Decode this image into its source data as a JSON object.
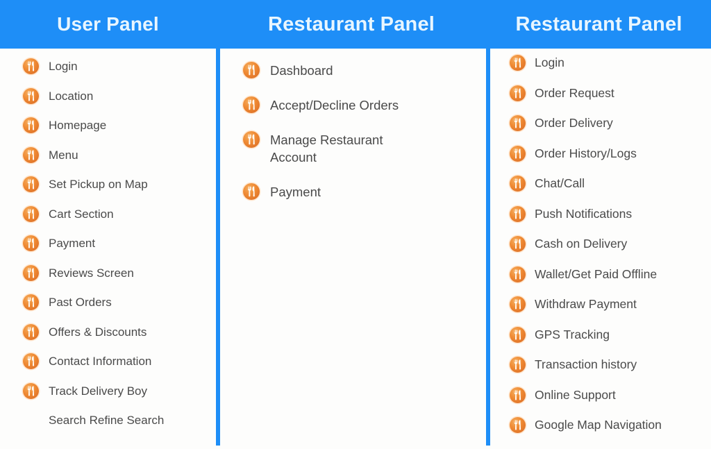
{
  "colors": {
    "header_blue": "#1e8ef7",
    "header_text": "#e8f6ff",
    "divider_blue": "#1e8ef7",
    "icon_orange": "#ef8a33",
    "label_text": "#4a4a4a",
    "background": "#fdfdfc"
  },
  "headers": {
    "col1": "User Panel",
    "col2": "Restaurant Panel",
    "col3": "Restaurant Panel"
  },
  "icon_name": "fork-and-spoon-icon",
  "columns": [
    {
      "key": "user_panel",
      "title": "User Panel",
      "items": [
        {
          "label": "Login",
          "has_icon": true
        },
        {
          "label": "Location",
          "has_icon": true
        },
        {
          "label": "Homepage",
          "has_icon": true
        },
        {
          "label": "Menu",
          "has_icon": true
        },
        {
          "label": "Set Pickup on Map",
          "has_icon": true
        },
        {
          "label": "Cart Section",
          "has_icon": true
        },
        {
          "label": "Payment",
          "has_icon": true
        },
        {
          "label": "Reviews Screen",
          "has_icon": true
        },
        {
          "label": "Past Orders",
          "has_icon": true
        },
        {
          "label": "Offers & Discounts",
          "has_icon": true
        },
        {
          "label": "Contact Information",
          "has_icon": true
        },
        {
          "label": "Track Delivery Boy",
          "has_icon": true
        },
        {
          "label": "Search Refine Search",
          "has_icon": false
        }
      ]
    },
    {
      "key": "restaurant_panel_1",
      "title": "Restaurant Panel",
      "items": [
        {
          "label": "Dashboard",
          "has_icon": true
        },
        {
          "label": "Accept/Decline Orders",
          "has_icon": true
        },
        {
          "label": "Manage Restaurant\nAccount",
          "has_icon": true
        },
        {
          "label": "Payment",
          "has_icon": true
        }
      ]
    },
    {
      "key": "restaurant_panel_2",
      "title": "Restaurant Panel",
      "items": [
        {
          "label": "Login",
          "has_icon": true
        },
        {
          "label": "Order Request",
          "has_icon": true
        },
        {
          "label": "Order Delivery",
          "has_icon": true
        },
        {
          "label": "Order History/Logs",
          "has_icon": true
        },
        {
          "label": "Chat/Call",
          "has_icon": true
        },
        {
          "label": "Push Notifications",
          "has_icon": true
        },
        {
          "label": "Cash on Delivery",
          "has_icon": true
        },
        {
          "label": "Wallet/Get Paid Offline",
          "has_icon": true
        },
        {
          "label": "Withdraw Payment",
          "has_icon": true
        },
        {
          "label": "GPS Tracking",
          "has_icon": true
        },
        {
          "label": "Transaction history",
          "has_icon": true
        },
        {
          "label": "Online Support",
          "has_icon": true
        },
        {
          "label": "Google Map Navigation",
          "has_icon": true
        }
      ]
    }
  ]
}
